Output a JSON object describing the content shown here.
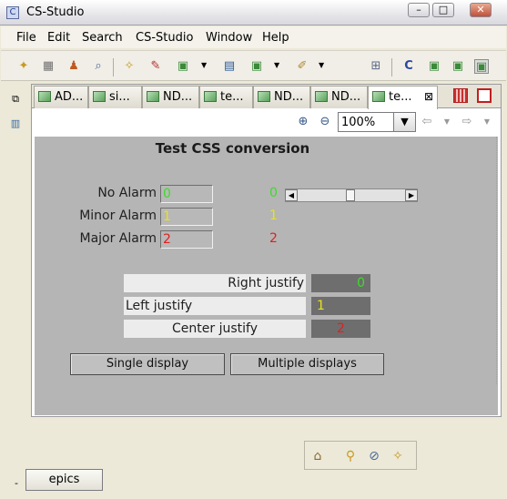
{
  "window": {
    "title": "CS-Studio",
    "min_label": "–",
    "max_label": "□",
    "close_label": "✕"
  },
  "menu": [
    "File",
    "Edit",
    "Search",
    "CS-Studio",
    "Window",
    "Help"
  ],
  "tabs": [
    {
      "label": "AD..."
    },
    {
      "label": "si..."
    },
    {
      "label": "ND..."
    },
    {
      "label": "te..."
    },
    {
      "label": "ND..."
    },
    {
      "label": "ND..."
    },
    {
      "label": "te...",
      "active": true,
      "close": "⊠"
    }
  ],
  "zoom": {
    "value": "100%"
  },
  "display": {
    "title": "Test CSS conversion",
    "alarms": [
      {
        "label": "No Alarm",
        "box_value": "0",
        "value": "0",
        "color": "#3ddc2a"
      },
      {
        "label": "Minor Alarm",
        "box_value": "1",
        "value": "1",
        "color": "#e8e21a"
      },
      {
        "label": "Major Alarm",
        "box_value": "2",
        "value": "2",
        "color": "#e02020"
      }
    ],
    "slider_fraction": 0.5,
    "justify": [
      {
        "label": "Right justify",
        "value": "0",
        "value_color": "#3ddc2a"
      },
      {
        "label": "Left justify",
        "value": "1",
        "value_color": "#e8e21a"
      },
      {
        "label": "Center justify",
        "value": "2",
        "value_color": "#e02020"
      }
    ],
    "buttons": {
      "single": "Single display",
      "multiple": "Multiple displays"
    }
  },
  "bottom": {
    "dash": "-",
    "perspective_tab": "epics"
  }
}
